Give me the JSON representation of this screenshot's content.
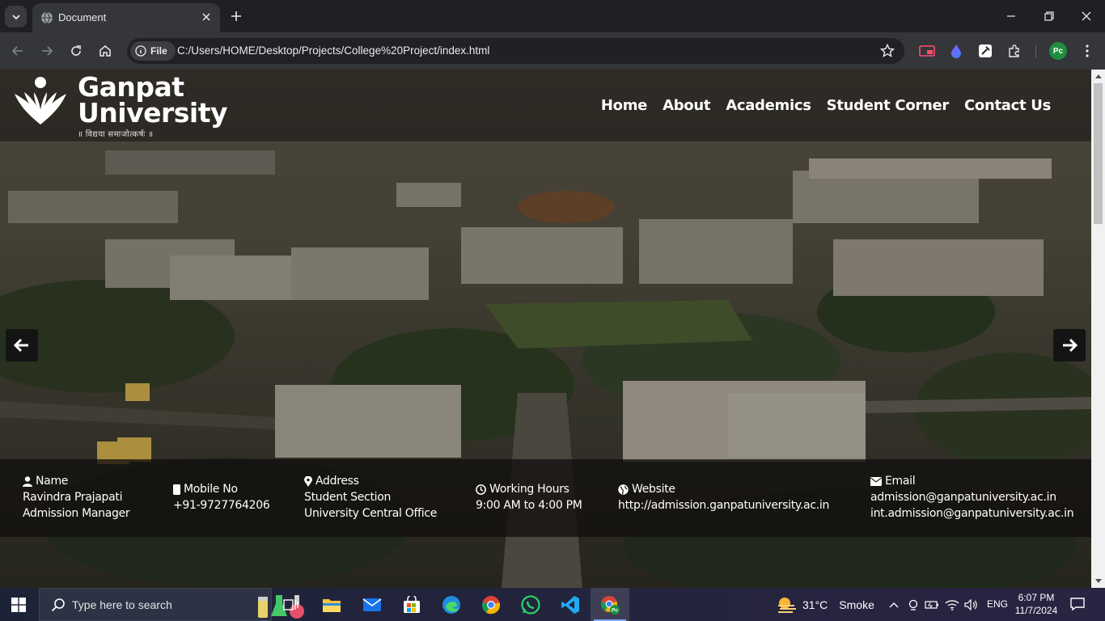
{
  "browser": {
    "tab_title": "Document",
    "url_chip": "File",
    "url": "C:/Users/HOME/Desktop/Projects/College%20Project/index.html",
    "profile_initials": "Pc"
  },
  "site": {
    "logo_line1": "Ganpat",
    "logo_line2": "University",
    "logo_motto": "॥ विद्यया समाजोत्कर्षः ॥",
    "nav": [
      "Home",
      "About",
      "Academics",
      "Student Corner",
      "Contact Us"
    ],
    "info": {
      "name": {
        "title": "Name",
        "lines": [
          "Ravindra Prajapati",
          "Admission Manager"
        ]
      },
      "mobile": {
        "title": "Mobile No",
        "lines": [
          "+91-9727764206"
        ]
      },
      "address": {
        "title": "Address",
        "lines": [
          "Student Section",
          "University Central Office"
        ]
      },
      "hours": {
        "title": "Working Hours",
        "lines": [
          "9:00 AM to 4:00 PM"
        ]
      },
      "website": {
        "title": "Website",
        "lines": [
          "http://admission.ganpatuniversity.ac.in"
        ]
      },
      "email": {
        "title": "Email",
        "lines": [
          "admission@ganpatuniversity.ac.in",
          "int.admission@ganpatuniversity.ac.in"
        ]
      }
    }
  },
  "taskbar": {
    "search_placeholder": "Type here to search",
    "weather_temp": "31°C",
    "weather_text": "Smoke",
    "lang": "ENG",
    "time": "6:07 PM",
    "date": "11/7/2024",
    "apps": [
      "task-view",
      "file-explorer",
      "mail",
      "microsoft-store",
      "edge",
      "chrome",
      "whatsapp",
      "vscode",
      "chrome-profile"
    ]
  },
  "colors": {
    "chrome_dark": "#1f2023",
    "chrome_toolbar": "#35363a",
    "profile_green": "#1e8e3e",
    "taskbar_bg": "#23243d"
  }
}
